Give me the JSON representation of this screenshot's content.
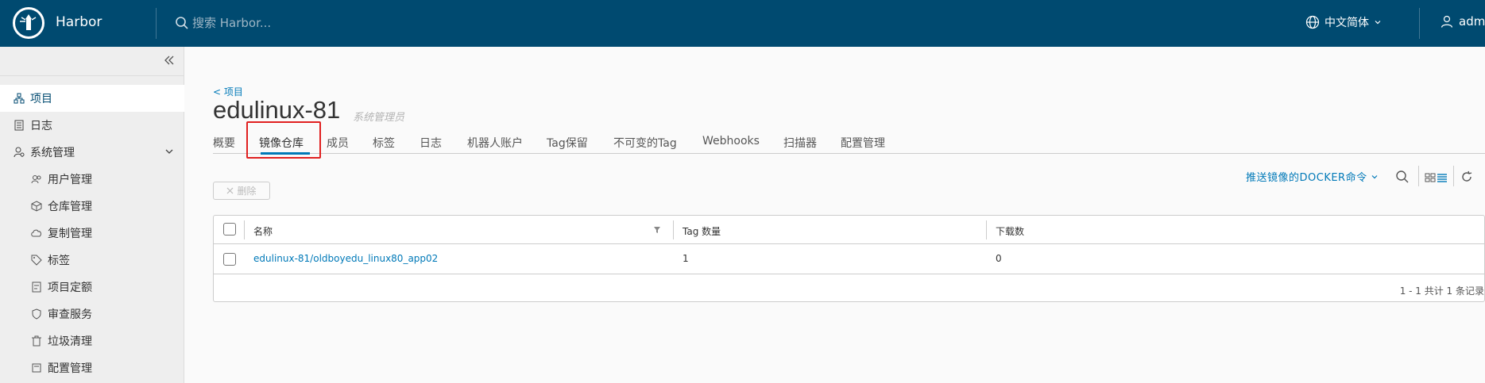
{
  "header": {
    "brand": "Harbor",
    "search_placeholder": "搜索 Harbor...",
    "language": "中文简体",
    "user": "admin"
  },
  "sidebar": {
    "items": [
      {
        "label": "项目",
        "icon": "projects-icon",
        "active": true
      },
      {
        "label": "日志",
        "icon": "logs-icon"
      },
      {
        "label": "系统管理",
        "icon": "system-admin-icon",
        "expanded": true
      },
      {
        "label": "用户管理",
        "icon": "users-icon",
        "sub": true
      },
      {
        "label": "仓库管理",
        "icon": "registries-icon",
        "sub": true
      },
      {
        "label": "复制管理",
        "icon": "replication-icon",
        "sub": true
      },
      {
        "label": "标签",
        "icon": "tag-icon",
        "sub": true
      },
      {
        "label": "项目定额",
        "icon": "quota-icon",
        "sub": true
      },
      {
        "label": "审查服务",
        "icon": "shield-icon",
        "sub": true
      },
      {
        "label": "垃圾清理",
        "icon": "trash-icon",
        "sub": true
      },
      {
        "label": "配置管理",
        "icon": "config-icon",
        "sub": true
      }
    ]
  },
  "project": {
    "back_label": "< 项目",
    "name": "edulinux-81",
    "role": "系统管理员"
  },
  "tabs": [
    "概要",
    "镜像仓库",
    "成员",
    "标签",
    "日志",
    "机器人账户",
    "Tag保留",
    "不可变的Tag",
    "Webhooks",
    "扫描器",
    "配置管理"
  ],
  "active_tab": "镜像仓库",
  "toolbar": {
    "push_command": "推送镜像的DOCKER命令",
    "delete_label": "删除"
  },
  "table": {
    "columns": [
      "名称",
      "Tag 数量",
      "下载数"
    ],
    "rows": [
      {
        "name": "edulinux-81/oldboyedu_linux80_app02",
        "tags": "1",
        "pulls": "0"
      }
    ],
    "footer": "1 - 1 共计 1 条记录"
  },
  "colors": {
    "header_bg": "#004a70",
    "accent": "#0079b8",
    "highlight_box": "#e02020"
  }
}
